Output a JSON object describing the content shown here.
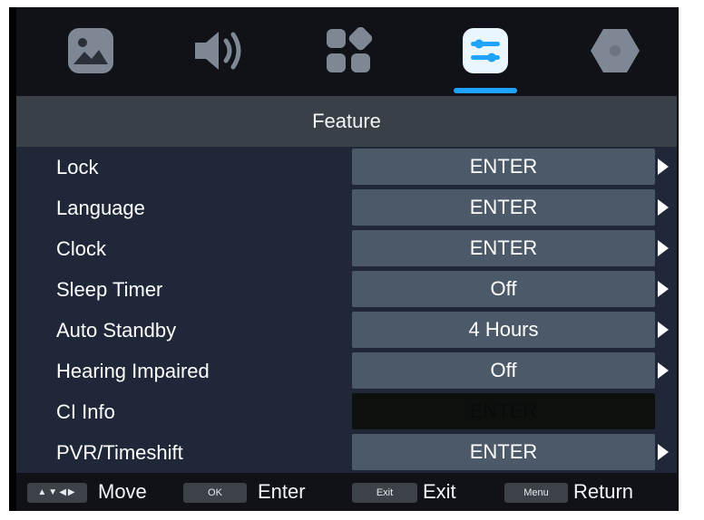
{
  "tabs": [
    {
      "icon": "picture-icon",
      "active": false
    },
    {
      "icon": "sound-icon",
      "active": false
    },
    {
      "icon": "apps-icon",
      "active": false
    },
    {
      "icon": "feature-sliders-icon",
      "active": true
    },
    {
      "icon": "settings-hexagon-icon",
      "active": false
    }
  ],
  "title": "Feature",
  "rows": [
    {
      "label": "Lock",
      "value": "ENTER",
      "arrow": true,
      "disabled": false
    },
    {
      "label": "Language",
      "value": "ENTER",
      "arrow": true,
      "disabled": false
    },
    {
      "label": "Clock",
      "value": "ENTER",
      "arrow": true,
      "disabled": false
    },
    {
      "label": "Sleep Timer",
      "value": "Off",
      "arrow": true,
      "disabled": false
    },
    {
      "label": "Auto Standby",
      "value": "4 Hours",
      "arrow": true,
      "disabled": false
    },
    {
      "label": "Hearing Impaired",
      "value": "Off",
      "arrow": true,
      "disabled": false
    },
    {
      "label": "CI Info",
      "value": "ENTER",
      "arrow": false,
      "disabled": true
    },
    {
      "label": "PVR/Timeshift",
      "value": "ENTER",
      "arrow": true,
      "disabled": false
    }
  ],
  "footer": {
    "move_key": "▲▼◀▶",
    "move_label": "Move",
    "ok_key": "OK",
    "ok_label": "Enter",
    "exit_key": "Exit",
    "exit_label": "Exit",
    "menu_key": "Menu",
    "menu_label": "Return"
  },
  "colors": {
    "accent": "#1fa3ff",
    "value_box": "#4b5968",
    "list_bg": "#1f2738",
    "title_bg": "#3a4048"
  }
}
